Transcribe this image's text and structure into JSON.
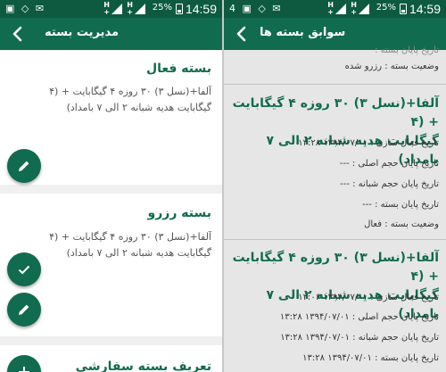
{
  "left": {
    "status": {
      "time": "14:59",
      "battery": "25%"
    },
    "appbar_title": "مدیریت بسته",
    "active_card": {
      "title": "بسته فعال",
      "line1": "آلفا+(نسل ۳) ۳۰ روزه ۴ گیگابایت + (۴",
      "line2": "گیگابایت هدیه شبانه ۲ الی ۷ بامداد)"
    },
    "reserve_card": {
      "title": "بسته رزرو",
      "line1": "آلفا+(نسل ۳) ۳۰ روزه ۴ گیگابایت + (۴",
      "line2": "گیگابایت هدیه شبانه ۲ الی ۷ بامداد)"
    },
    "define_card": {
      "title": "تعریف بسته سفارشی"
    }
  },
  "right": {
    "status": {
      "time": "14:59",
      "battery": "25%",
      "notif": "4"
    },
    "appbar_title": "سوابق بسته ها",
    "top_partial": {
      "row0": "تاریخ پایان بسته :",
      "row1": "وضعیت بسته : رزرو شده"
    },
    "entry1": {
      "title_line1": "آلفا+(نسل ۳) ۳۰ روزه ۴ گیگابایت + (۴",
      "title_line2": "گیگابایت هدیه شبانه ۲ الی ۷ بامداد)",
      "activation": "تاریخ فعال سازی : ۱۳۹۴/۰۷/۰۱ ۱۳:۲۸",
      "main_end": "تاریخ پایان حجم اصلی : ---",
      "night_end": "تاریخ پایان حجم شبانه : ---",
      "pkg_end": "تاریخ پایان بسته : ---",
      "state": "وضعیت بسته : فعال"
    },
    "entry2": {
      "title_line1": "آلفا+(نسل ۳) ۳۰ روزه ۴ گیگابایت + (۴",
      "title_line2": "گیگابایت هدیه شبانه ۲ الی ۷ بامداد)",
      "activation": "تاریخ فعال سازی : ۱۳۹۴/۰۷/۰۱ ۱۲:۰۶",
      "main_end": "تاریخ پایان حجم اصلی : ۱۳۹۴/۰۷/۰۱ ۱۳:۲۸",
      "night_end": "تاریخ پایان حجم شبانه : ۱۳۹۴/۰۷/۰۱ ۱۳:۲۸",
      "pkg_end": "تاریخ پایان بسته : ۱۳۹۴/۰۷/۰۱ ۱۳:۲۸"
    }
  },
  "icons": {
    "back": "arrow-left-icon",
    "edit": "pencil-icon",
    "confirm": "check-icon",
    "add": "plus-icon"
  },
  "colors": {
    "primary": "#116b4e",
    "statusbar": "#0d5a40",
    "title": "#116b4e"
  }
}
